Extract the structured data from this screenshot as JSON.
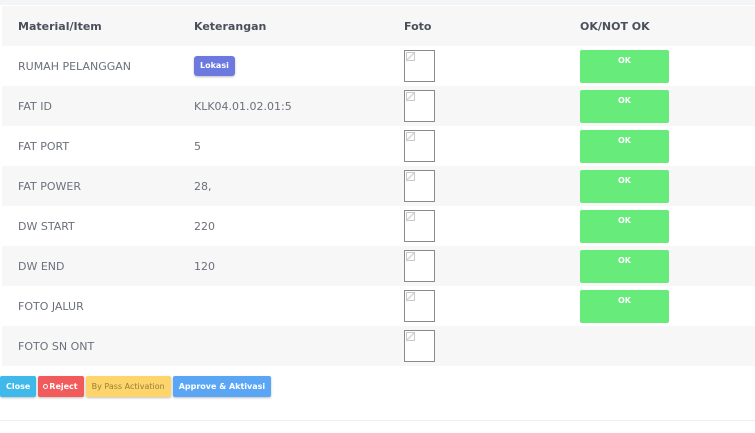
{
  "table": {
    "headers": {
      "item": "Material/Item",
      "keterangan": "Keterangan",
      "foto": "Foto",
      "status": "OK/NOT OK"
    },
    "rows": [
      {
        "item": "RUMAH PELANGGAN",
        "keterangan": "",
        "badge": "Lokasi",
        "status": "OK"
      },
      {
        "item": "FAT ID",
        "keterangan": "KLK04.01.02.01:5",
        "status": "OK"
      },
      {
        "item": "FAT PORT",
        "keterangan": "5",
        "status": "OK"
      },
      {
        "item": "FAT POWER",
        "keterangan": "28,",
        "status": "OK"
      },
      {
        "item": "DW START",
        "keterangan": "220",
        "status": "OK"
      },
      {
        "item": "DW END",
        "keterangan": "120",
        "status": "OK"
      },
      {
        "item": "FOTO JALUR",
        "keterangan": "",
        "status": "OK"
      },
      {
        "item": "FOTO SN ONT",
        "keterangan": "",
        "status": ""
      }
    ]
  },
  "actions": {
    "close": "Close",
    "reject": "Reject",
    "bypass": "By Pass Activation",
    "approve": "Approve & Aktivasi"
  },
  "colors": {
    "ok_green": "#67eb7a",
    "badge_purple": "#6c7ae0",
    "close_blue": "#3fb8ea",
    "reject_red": "#f15b5b",
    "bypass_yellow": "#fdd56a",
    "approve_blue": "#5aa6f5"
  }
}
